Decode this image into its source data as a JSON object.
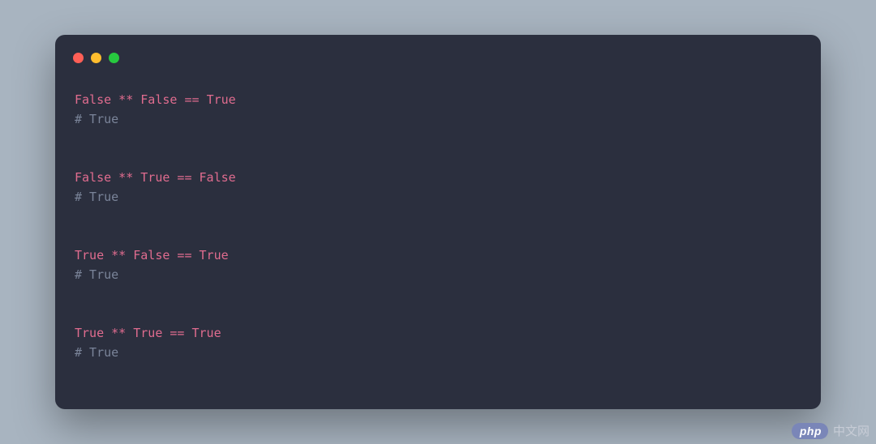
{
  "code": {
    "lines": [
      {
        "type": "expr",
        "tokens": [
          {
            "cls": "kw",
            "t": "False"
          },
          {
            "cls": "op",
            "t": " ** "
          },
          {
            "cls": "kw",
            "t": "False"
          },
          {
            "cls": "op",
            "t": " == "
          },
          {
            "cls": "kw",
            "t": "True"
          }
        ]
      },
      {
        "type": "comment",
        "t": "# True"
      },
      {
        "type": "blank"
      },
      {
        "type": "expr",
        "tokens": [
          {
            "cls": "kw",
            "t": "False"
          },
          {
            "cls": "op",
            "t": " ** "
          },
          {
            "cls": "kw",
            "t": "True"
          },
          {
            "cls": "op",
            "t": " == "
          },
          {
            "cls": "kw",
            "t": "False"
          }
        ]
      },
      {
        "type": "comment",
        "t": "# True"
      },
      {
        "type": "blank"
      },
      {
        "type": "expr",
        "tokens": [
          {
            "cls": "kw",
            "t": "True"
          },
          {
            "cls": "op",
            "t": " ** "
          },
          {
            "cls": "kw",
            "t": "False"
          },
          {
            "cls": "op",
            "t": " == "
          },
          {
            "cls": "kw",
            "t": "True"
          }
        ]
      },
      {
        "type": "comment",
        "t": "# True"
      },
      {
        "type": "blank"
      },
      {
        "type": "expr",
        "tokens": [
          {
            "cls": "kw",
            "t": "True"
          },
          {
            "cls": "op",
            "t": " ** "
          },
          {
            "cls": "kw",
            "t": "True"
          },
          {
            "cls": "op",
            "t": " == "
          },
          {
            "cls": "kw",
            "t": "True"
          }
        ]
      },
      {
        "type": "comment",
        "t": "# True"
      }
    ]
  },
  "watermark": {
    "badge": "php",
    "text": "中文网"
  }
}
